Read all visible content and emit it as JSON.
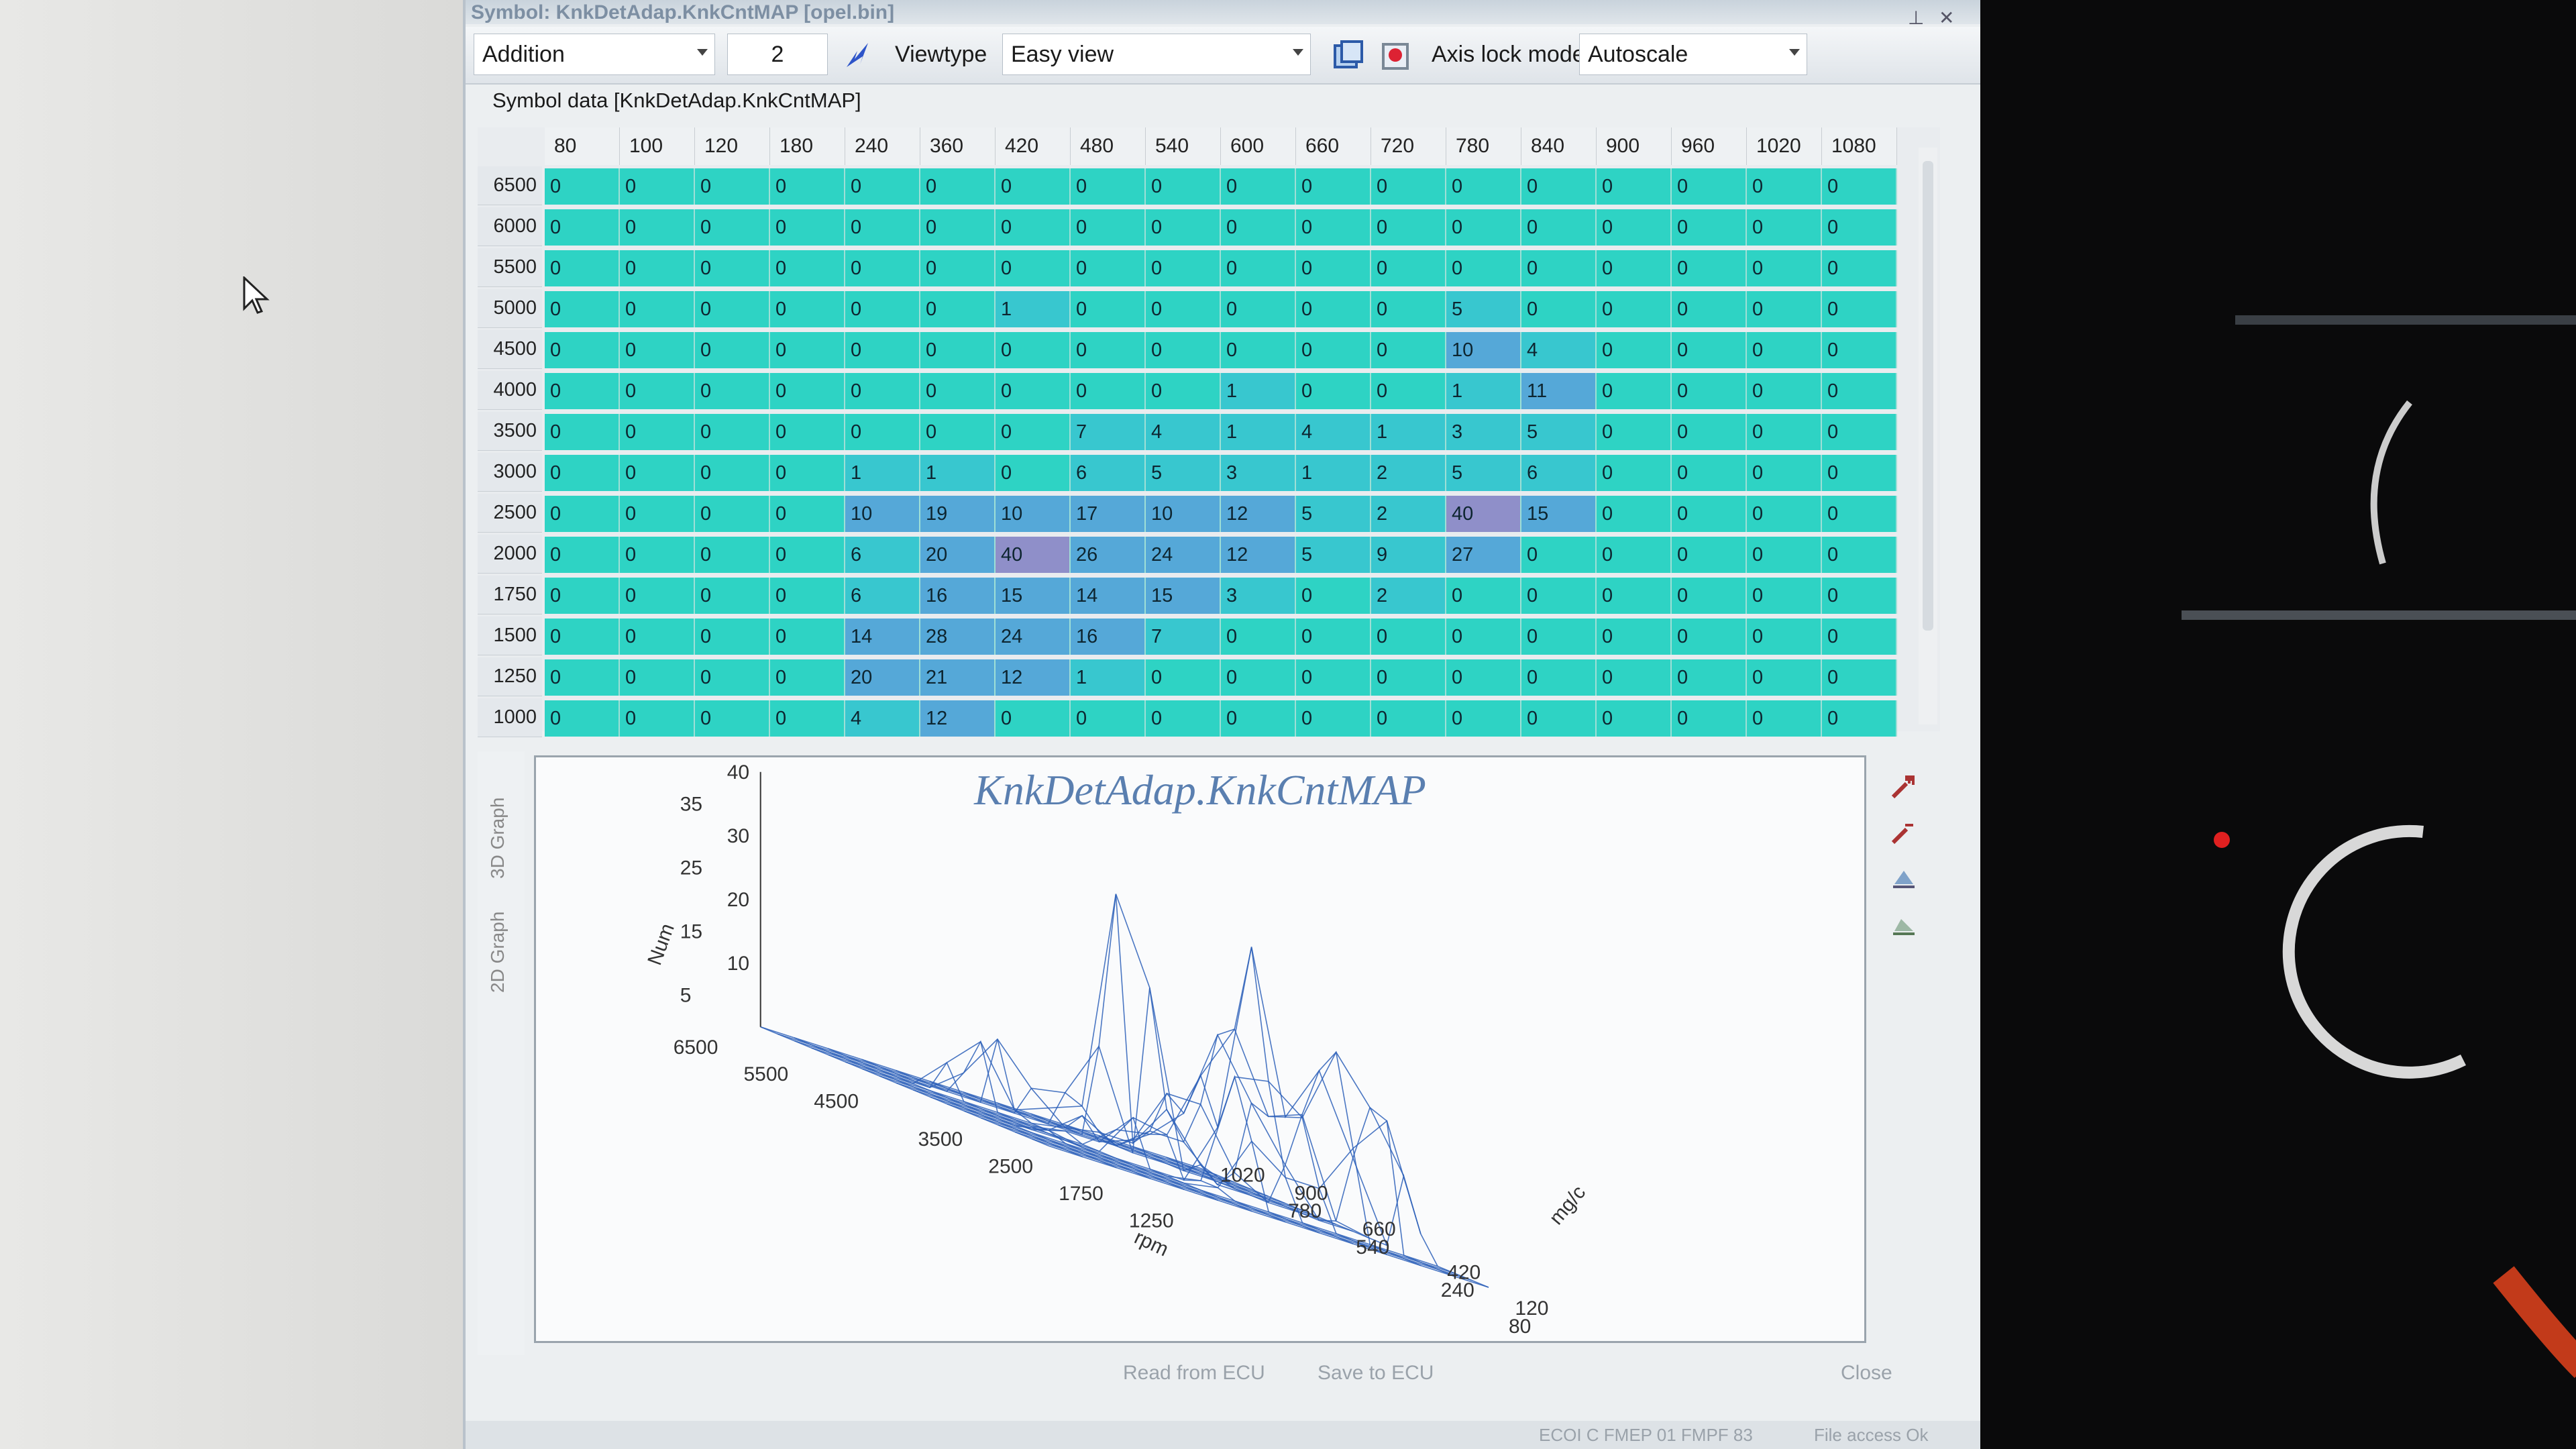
{
  "window": {
    "title": "Symbol: KnkDetAdap.KnkCntMAP [opel.bin]",
    "pin_glyph": "⊥",
    "close_glyph": "✕"
  },
  "toolbar": {
    "operation": "Addition",
    "value": "2",
    "viewtype_label": "Viewtype",
    "viewtype_value": "Easy view",
    "axis_lock_label": "Axis lock mode",
    "axis_lock_value": "Autoscale"
  },
  "symbol_panel_title": "Symbol data [KnkDetAdap.KnkCntMAP]",
  "table": {
    "columns": [
      "80",
      "100",
      "120",
      "180",
      "240",
      "360",
      "420",
      "480",
      "540",
      "600",
      "660",
      "720",
      "780",
      "840",
      "900",
      "960",
      "1020",
      "1080"
    ],
    "rows": [
      {
        "label": "6500",
        "values": [
          0,
          0,
          0,
          0,
          0,
          0,
          0,
          0,
          0,
          0,
          0,
          0,
          0,
          0,
          0,
          0,
          0,
          0
        ]
      },
      {
        "label": "6000",
        "values": [
          0,
          0,
          0,
          0,
          0,
          0,
          0,
          0,
          0,
          0,
          0,
          0,
          0,
          0,
          0,
          0,
          0,
          0
        ]
      },
      {
        "label": "5500",
        "values": [
          0,
          0,
          0,
          0,
          0,
          0,
          0,
          0,
          0,
          0,
          0,
          0,
          0,
          0,
          0,
          0,
          0,
          0
        ]
      },
      {
        "label": "5000",
        "values": [
          0,
          0,
          0,
          0,
          0,
          0,
          1,
          0,
          0,
          0,
          0,
          0,
          5,
          0,
          0,
          0,
          0,
          0
        ]
      },
      {
        "label": "4500",
        "values": [
          0,
          0,
          0,
          0,
          0,
          0,
          0,
          0,
          0,
          0,
          0,
          0,
          10,
          4,
          0,
          0,
          0,
          0
        ]
      },
      {
        "label": "4000",
        "values": [
          0,
          0,
          0,
          0,
          0,
          0,
          0,
          0,
          0,
          1,
          0,
          0,
          1,
          11,
          0,
          0,
          0,
          0
        ]
      },
      {
        "label": "3500",
        "values": [
          0,
          0,
          0,
          0,
          0,
          0,
          0,
          7,
          4,
          1,
          4,
          1,
          3,
          5,
          0,
          0,
          0,
          0
        ]
      },
      {
        "label": "3000",
        "values": [
          0,
          0,
          0,
          0,
          1,
          1,
          0,
          6,
          5,
          3,
          1,
          2,
          5,
          6,
          0,
          0,
          0,
          0
        ]
      },
      {
        "label": "2500",
        "values": [
          0,
          0,
          0,
          0,
          10,
          19,
          10,
          17,
          10,
          12,
          5,
          2,
          40,
          15,
          0,
          0,
          0,
          0
        ]
      },
      {
        "label": "2000",
        "values": [
          0,
          0,
          0,
          0,
          6,
          20,
          40,
          26,
          24,
          12,
          5,
          9,
          27,
          0,
          0,
          0,
          0,
          0
        ]
      },
      {
        "label": "1750",
        "values": [
          0,
          0,
          0,
          0,
          6,
          16,
          15,
          14,
          15,
          3,
          0,
          2,
          0,
          0,
          0,
          0,
          0,
          0
        ]
      },
      {
        "label": "1500",
        "values": [
          0,
          0,
          0,
          0,
          14,
          28,
          24,
          16,
          7,
          0,
          0,
          0,
          0,
          0,
          0,
          0,
          0,
          0
        ]
      },
      {
        "label": "1250",
        "values": [
          0,
          0,
          0,
          0,
          20,
          21,
          12,
          1,
          0,
          0,
          0,
          0,
          0,
          0,
          0,
          0,
          0,
          0
        ]
      },
      {
        "label": "1000",
        "values": [
          0,
          0,
          0,
          0,
          4,
          12,
          0,
          0,
          0,
          0,
          0,
          0,
          0,
          0,
          0,
          0,
          0,
          0
        ]
      }
    ]
  },
  "graph": {
    "tab_3d": "3D Graph",
    "tab_2d": "2D Graph",
    "title": "KnkDetAdap.KnkCntMAP",
    "z_axis_label": "Num",
    "z_ticks_left": [
      "35",
      "25",
      "15",
      "5"
    ],
    "z_ticks_right": [
      "40",
      "30",
      "20",
      "10"
    ],
    "rpm_axis_label": "rpm",
    "rpm_ticks": [
      "6500",
      "5500",
      "4500",
      "3500",
      "2500",
      "1750",
      "1250"
    ],
    "load_axis_label": "mg/c",
    "load_ticks": [
      "1020",
      "900",
      "780",
      "660",
      "540",
      "420",
      "240",
      "120",
      "80"
    ],
    "surface_color": "#2b5fb8"
  },
  "buttons": {
    "read": "Read from ECU",
    "save": "Save to ECU",
    "close": "Close"
  },
  "status": {
    "left": "ECOI C FMEP 01 FMPF 83",
    "right": "File access Ok"
  },
  "colors": {
    "cell_zero": "#2ed3c4",
    "cell_low": "#38c7cf",
    "cell_mid": "#55a8d8",
    "cell_high": "#8f8fc9",
    "accent": "#5a7fb0"
  }
}
